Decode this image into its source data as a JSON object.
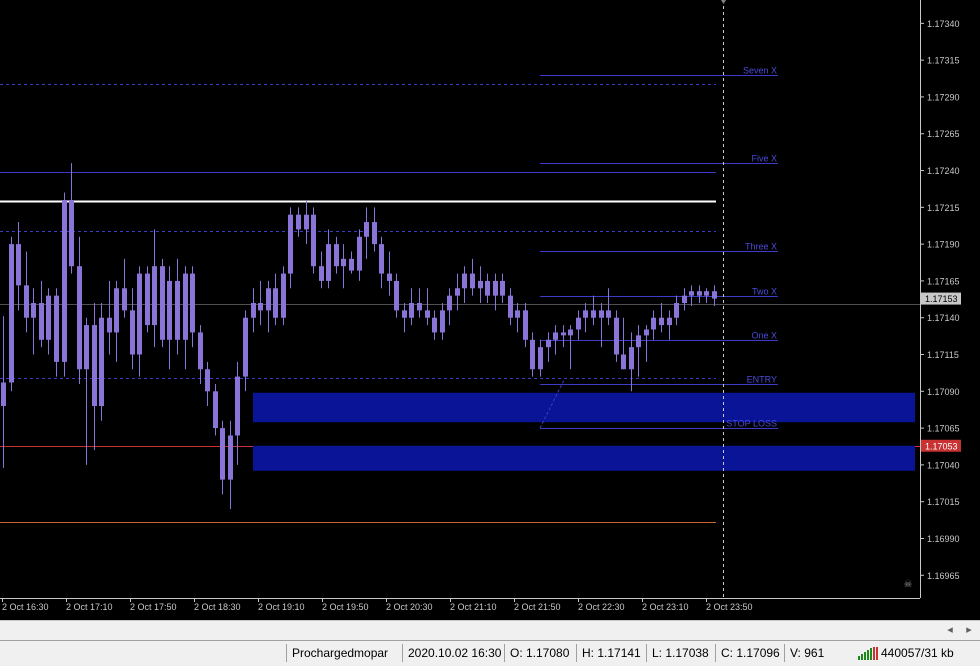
{
  "chart": {
    "price_min": 1.16955,
    "price_max": 1.17345,
    "colors": {
      "background": "#000000",
      "candle": "#8a74d8",
      "axis_text": "#c8c8c8",
      "level_line": "#3c3cc8",
      "zone_fill": "#0a1496",
      "resistance": "#ffffff",
      "support": "#c86432",
      "red_line": "#c83232",
      "bid_label_bg": "#c8c8c8",
      "ask_label_bg": "#c83232"
    },
    "price_ticks": [
      "1.17340",
      "1.17315",
      "1.17290",
      "1.17265",
      "1.17240",
      "1.17215",
      "1.17190",
      "1.17165",
      "1.17140",
      "1.17115",
      "1.17090",
      "1.17065",
      "1.17040",
      "1.17015",
      "1.16990",
      "1.16965"
    ],
    "time_ticks": [
      "2 Oct 16:30",
      "2 Oct 17:10",
      "2 Oct 17:50",
      "2 Oct 18:30",
      "2 Oct 19:10",
      "2 Oct 19:50",
      "2 Oct 20:30",
      "2 Oct 21:10",
      "2 Oct 21:50",
      "2 Oct 22:30",
      "2 Oct 23:10",
      "2 Oct 23:50"
    ],
    "current_bid_label": "1.17153",
    "current_ask_label": "1.17053",
    "current_bid": 1.17153,
    "current_ask": 1.17053,
    "target_levels": [
      {
        "label": "Seven X",
        "price": 1.17305
      },
      {
        "label": "Five X",
        "price": 1.17245
      },
      {
        "label": "Three X",
        "price": 1.17185
      },
      {
        "label": "Two X",
        "price": 1.17155
      },
      {
        "label": "One X",
        "price": 1.17125
      },
      {
        "label": "ENTRY",
        "price": 1.17095
      },
      {
        "label": "STOP LOSS",
        "price": 1.17065
      }
    ],
    "horizontal_lines": [
      {
        "price": 1.17299,
        "style": "dashed",
        "color": "#3c3cc8"
      },
      {
        "price": 1.17239,
        "style": "solid",
        "color": "#3c3cc8"
      },
      {
        "price": 1.17219,
        "style": "solid",
        "color": "#ffffff"
      },
      {
        "price": 1.17199,
        "style": "dashed",
        "color": "#3c3cc8"
      },
      {
        "price": 1.17149,
        "style": "solid",
        "color": "#505050"
      },
      {
        "price": 1.17099,
        "style": "dashed",
        "color": "#3c3cc8"
      },
      {
        "price": 1.17053,
        "style": "solid",
        "color": "#c83232"
      },
      {
        "price": 1.17001,
        "style": "solid",
        "color": "#c86432"
      }
    ],
    "zones": [
      {
        "top": 1.17089,
        "bottom": 1.17069
      },
      {
        "top": 1.17053,
        "bottom": 1.17036
      }
    ],
    "candles": [
      {
        "o": 1.1708,
        "h": 1.17141,
        "l": 1.17038,
        "c": 1.17096
      },
      {
        "o": 1.17096,
        "h": 1.17195,
        "l": 1.1709,
        "c": 1.1719
      },
      {
        "o": 1.1719,
        "h": 1.17205,
        "l": 1.17145,
        "c": 1.17162
      },
      {
        "o": 1.17162,
        "h": 1.17185,
        "l": 1.1713,
        "c": 1.1714
      },
      {
        "o": 1.1714,
        "h": 1.1716,
        "l": 1.17115,
        "c": 1.1715
      },
      {
        "o": 1.1715,
        "h": 1.17165,
        "l": 1.1712,
        "c": 1.17125
      },
      {
        "o": 1.17125,
        "h": 1.1716,
        "l": 1.17115,
        "c": 1.17155
      },
      {
        "o": 1.17155,
        "h": 1.1716,
        "l": 1.171,
        "c": 1.1711
      },
      {
        "o": 1.1711,
        "h": 1.17225,
        "l": 1.171,
        "c": 1.1722
      },
      {
        "o": 1.1722,
        "h": 1.17245,
        "l": 1.1717,
        "c": 1.17175
      },
      {
        "o": 1.17175,
        "h": 1.17195,
        "l": 1.17095,
        "c": 1.17105
      },
      {
        "o": 1.17105,
        "h": 1.1714,
        "l": 1.1704,
        "c": 1.17135
      },
      {
        "o": 1.17135,
        "h": 1.1715,
        "l": 1.1705,
        "c": 1.1708
      },
      {
        "o": 1.1708,
        "h": 1.1715,
        "l": 1.1707,
        "c": 1.1714
      },
      {
        "o": 1.1714,
        "h": 1.17165,
        "l": 1.17115,
        "c": 1.1713
      },
      {
        "o": 1.1713,
        "h": 1.17165,
        "l": 1.1711,
        "c": 1.1716
      },
      {
        "o": 1.1716,
        "h": 1.1718,
        "l": 1.1714,
        "c": 1.17145
      },
      {
        "o": 1.17145,
        "h": 1.1716,
        "l": 1.17105,
        "c": 1.17115
      },
      {
        "o": 1.17115,
        "h": 1.17175,
        "l": 1.171,
        "c": 1.1717
      },
      {
        "o": 1.1717,
        "h": 1.17175,
        "l": 1.1713,
        "c": 1.17135
      },
      {
        "o": 1.17135,
        "h": 1.172,
        "l": 1.1712,
        "c": 1.17175
      },
      {
        "o": 1.17175,
        "h": 1.1718,
        "l": 1.1712,
        "c": 1.17125
      },
      {
        "o": 1.17125,
        "h": 1.17175,
        "l": 1.17105,
        "c": 1.17165
      },
      {
        "o": 1.17165,
        "h": 1.1718,
        "l": 1.17115,
        "c": 1.17125
      },
      {
        "o": 1.17125,
        "h": 1.17175,
        "l": 1.17105,
        "c": 1.1717
      },
      {
        "o": 1.1717,
        "h": 1.17175,
        "l": 1.1712,
        "c": 1.1713
      },
      {
        "o": 1.1713,
        "h": 1.17135,
        "l": 1.17095,
        "c": 1.17105
      },
      {
        "o": 1.17105,
        "h": 1.1711,
        "l": 1.1708,
        "c": 1.1709
      },
      {
        "o": 1.1709,
        "h": 1.17095,
        "l": 1.1706,
        "c": 1.17065
      },
      {
        "o": 1.17065,
        "h": 1.1707,
        "l": 1.1702,
        "c": 1.1703
      },
      {
        "o": 1.1703,
        "h": 1.1707,
        "l": 1.1701,
        "c": 1.1706
      },
      {
        "o": 1.1706,
        "h": 1.1711,
        "l": 1.1704,
        "c": 1.171
      },
      {
        "o": 1.171,
        "h": 1.17145,
        "l": 1.1709,
        "c": 1.1714
      },
      {
        "o": 1.1714,
        "h": 1.1716,
        "l": 1.1713,
        "c": 1.1715
      },
      {
        "o": 1.1715,
        "h": 1.17165,
        "l": 1.17135,
        "c": 1.17145
      },
      {
        "o": 1.17145,
        "h": 1.17165,
        "l": 1.1713,
        "c": 1.1716
      },
      {
        "o": 1.1716,
        "h": 1.1717,
        "l": 1.17135,
        "c": 1.1714
      },
      {
        "o": 1.1714,
        "h": 1.17175,
        "l": 1.17135,
        "c": 1.1717
      },
      {
        "o": 1.1717,
        "h": 1.17215,
        "l": 1.1716,
        "c": 1.1721
      },
      {
        "o": 1.1721,
        "h": 1.17215,
        "l": 1.17195,
        "c": 1.172
      },
      {
        "o": 1.172,
        "h": 1.1722,
        "l": 1.1719,
        "c": 1.1721
      },
      {
        "o": 1.1721,
        "h": 1.17215,
        "l": 1.1717,
        "c": 1.17175
      },
      {
        "o": 1.17175,
        "h": 1.17185,
        "l": 1.1716,
        "c": 1.17165
      },
      {
        "o": 1.17165,
        "h": 1.172,
        "l": 1.1716,
        "c": 1.1719
      },
      {
        "o": 1.1719,
        "h": 1.17195,
        "l": 1.1717,
        "c": 1.17175
      },
      {
        "o": 1.17175,
        "h": 1.1719,
        "l": 1.1716,
        "c": 1.1718
      },
      {
        "o": 1.1718,
        "h": 1.17185,
        "l": 1.1717,
        "c": 1.17172
      },
      {
        "o": 1.17172,
        "h": 1.172,
        "l": 1.17165,
        "c": 1.17195
      },
      {
        "o": 1.17195,
        "h": 1.17215,
        "l": 1.1718,
        "c": 1.17205
      },
      {
        "o": 1.17205,
        "h": 1.17215,
        "l": 1.17185,
        "c": 1.1719
      },
      {
        "o": 1.1719,
        "h": 1.17195,
        "l": 1.1716,
        "c": 1.1717
      },
      {
        "o": 1.1717,
        "h": 1.17185,
        "l": 1.17155,
        "c": 1.17165
      },
      {
        "o": 1.17165,
        "h": 1.1717,
        "l": 1.1714,
        "c": 1.17145
      },
      {
        "o": 1.17145,
        "h": 1.1715,
        "l": 1.1713,
        "c": 1.1714
      },
      {
        "o": 1.1714,
        "h": 1.1716,
        "l": 1.17135,
        "c": 1.1715
      },
      {
        "o": 1.1715,
        "h": 1.1716,
        "l": 1.1714,
        "c": 1.17145
      },
      {
        "o": 1.17145,
        "h": 1.1716,
        "l": 1.17135,
        "c": 1.1714
      },
      {
        "o": 1.1714,
        "h": 1.17145,
        "l": 1.17125,
        "c": 1.1713
      },
      {
        "o": 1.1713,
        "h": 1.1715,
        "l": 1.17125,
        "c": 1.17145
      },
      {
        "o": 1.17145,
        "h": 1.1716,
        "l": 1.17135,
        "c": 1.17155
      },
      {
        "o": 1.17155,
        "h": 1.1717,
        "l": 1.17145,
        "c": 1.1716
      },
      {
        "o": 1.1716,
        "h": 1.17175,
        "l": 1.1715,
        "c": 1.1717
      },
      {
        "o": 1.1717,
        "h": 1.1718,
        "l": 1.17155,
        "c": 1.1716
      },
      {
        "o": 1.1716,
        "h": 1.17175,
        "l": 1.1715,
        "c": 1.17165
      },
      {
        "o": 1.17165,
        "h": 1.1717,
        "l": 1.1715,
        "c": 1.17155
      },
      {
        "o": 1.17155,
        "h": 1.1717,
        "l": 1.17145,
        "c": 1.17165
      },
      {
        "o": 1.17165,
        "h": 1.1717,
        "l": 1.1715,
        "c": 1.17155
      },
      {
        "o": 1.17155,
        "h": 1.1716,
        "l": 1.17135,
        "c": 1.1714
      },
      {
        "o": 1.1714,
        "h": 1.1715,
        "l": 1.1713,
        "c": 1.17145
      },
      {
        "o": 1.17145,
        "h": 1.1715,
        "l": 1.1712,
        "c": 1.17125
      },
      {
        "o": 1.17125,
        "h": 1.1713,
        "l": 1.171,
        "c": 1.17105
      },
      {
        "o": 1.17105,
        "h": 1.17125,
        "l": 1.171,
        "c": 1.1712
      },
      {
        "o": 1.1712,
        "h": 1.1713,
        "l": 1.1711,
        "c": 1.17125
      },
      {
        "o": 1.17125,
        "h": 1.17135,
        "l": 1.17115,
        "c": 1.1713
      },
      {
        "o": 1.1713,
        "h": 1.17135,
        "l": 1.1712,
        "c": 1.17128
      },
      {
        "o": 1.17128,
        "h": 1.17135,
        "l": 1.17105,
        "c": 1.17132
      },
      {
        "o": 1.17132,
        "h": 1.17145,
        "l": 1.17125,
        "c": 1.1714
      },
      {
        "o": 1.1714,
        "h": 1.1715,
        "l": 1.1713,
        "c": 1.17145
      },
      {
        "o": 1.17145,
        "h": 1.17155,
        "l": 1.17135,
        "c": 1.1714
      },
      {
        "o": 1.1714,
        "h": 1.1715,
        "l": 1.1712,
        "c": 1.17145
      },
      {
        "o": 1.17145,
        "h": 1.1716,
        "l": 1.17135,
        "c": 1.1714
      },
      {
        "o": 1.1714,
        "h": 1.17145,
        "l": 1.1711,
        "c": 1.17115
      },
      {
        "o": 1.17115,
        "h": 1.1714,
        "l": 1.17105,
        "c": 1.17105
      },
      {
        "o": 1.17105,
        "h": 1.1713,
        "l": 1.1709,
        "c": 1.1712
      },
      {
        "o": 1.1712,
        "h": 1.17135,
        "l": 1.171,
        "c": 1.17128
      },
      {
        "o": 1.17128,
        "h": 1.17135,
        "l": 1.1711,
        "c": 1.17132
      },
      {
        "o": 1.17132,
        "h": 1.17145,
        "l": 1.17125,
        "c": 1.1714
      },
      {
        "o": 1.1714,
        "h": 1.1715,
        "l": 1.1713,
        "c": 1.17135
      },
      {
        "o": 1.17135,
        "h": 1.17145,
        "l": 1.17125,
        "c": 1.1714
      },
      {
        "o": 1.1714,
        "h": 1.17155,
        "l": 1.17135,
        "c": 1.1715
      },
      {
        "o": 1.1715,
        "h": 1.1716,
        "l": 1.17145,
        "c": 1.17155
      },
      {
        "o": 1.17155,
        "h": 1.17162,
        "l": 1.17148,
        "c": 1.17158
      },
      {
        "o": 1.17158,
        "h": 1.17162,
        "l": 1.1715,
        "c": 1.17155
      },
      {
        "o": 1.17155,
        "h": 1.1716,
        "l": 1.1715,
        "c": 1.17158
      },
      {
        "o": 1.17158,
        "h": 1.17162,
        "l": 1.17148,
        "c": 1.17153
      }
    ]
  },
  "status_bar": {
    "profile": "Prochargedmopar",
    "datetime": "2020.10.02 16:30",
    "open": "O: 1.17080",
    "high": "H: 1.17141",
    "low": "L: 1.17038",
    "close": "C: 1.17096",
    "volume": "V: 961",
    "traffic": "440057/31 kb"
  }
}
